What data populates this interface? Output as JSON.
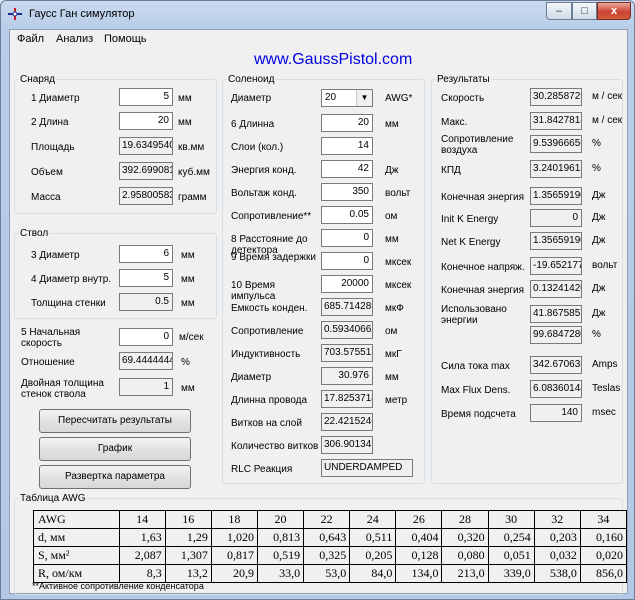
{
  "window": {
    "title": "Гаусс Ган симулятор",
    "min_glyph": "–",
    "max_glyph": "□",
    "close_glyph": "x"
  },
  "menu": {
    "file": "Файл",
    "analysis": "Анализ",
    "help": "Помощь"
  },
  "url": "www.GaussPistol.com",
  "projectile": {
    "legend": "Снаряд",
    "rows": [
      {
        "label": "1 Диаметр",
        "value": "5",
        "unit": "мм"
      },
      {
        "label": "2 Длина",
        "value": "20",
        "unit": "мм"
      },
      {
        "label": "Площадь",
        "value": "19.6349540",
        "unit": "кв.мм"
      },
      {
        "label": "Объем",
        "value": "392.699081",
        "unit": "куб.мм"
      },
      {
        "label": "Масса",
        "value": "2.95800583",
        "unit": "грамм"
      }
    ]
  },
  "barrel": {
    "legend": "Ствол",
    "rows": [
      {
        "label": "3 Диаметр",
        "value": "6",
        "unit": "мм"
      },
      {
        "label": "4 Диаметр внутр.",
        "value": "5",
        "unit": "мм"
      },
      {
        "label": "Толщина стенки",
        "value": "0.5",
        "unit": "мм"
      }
    ]
  },
  "misc": {
    "speed_label": "5 Начальная скорость",
    "speed_value": "0",
    "speed_unit": "м/сек",
    "ratio_label": "Отношение",
    "ratio_value": "69.4444444",
    "ratio_unit": "%",
    "double_label": "Двойная толщина стенок ствола",
    "double_value": "1",
    "double_unit": "мм"
  },
  "buttons": {
    "recalc": "Пересчитать результаты",
    "graph": "График",
    "sweep": "Развертка параметра"
  },
  "solenoid": {
    "legend": "Соленоид",
    "awg_label": "Диаметр",
    "awg_value": "20",
    "awg_unit": "AWG*",
    "rows": [
      {
        "label": "6 Длинна",
        "value": "20",
        "unit": "мм"
      },
      {
        "label": "Слои (кол.)",
        "value": "14",
        "unit": ""
      },
      {
        "label": "Энергия конд.",
        "value": "42",
        "unit": "Дж"
      },
      {
        "label": "Вольтаж конд.",
        "value": "350",
        "unit": "вольт"
      },
      {
        "label": "Сопротивление**",
        "value": "0.05",
        "unit": "ом"
      },
      {
        "label": "8 Расстояние до детектора",
        "value": "0",
        "unit": "мм"
      },
      {
        "label": "9 Время задержки",
        "value": "0",
        "unit": "мксек"
      },
      {
        "label": "10 Время импульса",
        "value": "20000",
        "unit": "мксек"
      },
      {
        "label": "Емкость конден.",
        "value": "685.714285",
        "unit": "мкФ"
      },
      {
        "label": "Сопротивление",
        "value": "0.59340662",
        "unit": "ом"
      },
      {
        "label": "Индуктивность",
        "value": "703.575513",
        "unit": "мкГ"
      },
      {
        "label": "Диаметр",
        "value": "30.976",
        "unit": "мм"
      },
      {
        "label": "Длинна провода",
        "value": "17.8253718",
        "unit": "метр"
      },
      {
        "label": "Витков на слой",
        "value": "22.4215246",
        "unit": ""
      },
      {
        "label": "Количество витков",
        "value": "306.901345",
        "unit": ""
      },
      {
        "label": "RLC Реакция",
        "value": "UNDERDAMPED",
        "unit": ""
      }
    ]
  },
  "results": {
    "legend": "Результаты",
    "rows": [
      {
        "label": "Скорость",
        "value": "30.2858729",
        "unit": "м / сек"
      },
      {
        "label": "Макс.",
        "value": "31.8427818",
        "unit": "м / сек"
      },
      {
        "label": "Сопротивление воздуха",
        "value": "9.53966656",
        "unit": "%"
      },
      {
        "label": "КПД",
        "value": "3.24019615",
        "unit": "%"
      },
      {
        "label": "Конечная энергия",
        "value": "1.35659190",
        "unit": "Дж"
      },
      {
        "label": "Init K Energy",
        "value": "0",
        "unit": "Дж"
      },
      {
        "label": "Net K Energy",
        "value": "1.35659190",
        "unit": "Дж"
      },
      {
        "label": "Конечное напряж.",
        "value": "-19.652177",
        "unit": "вольт"
      },
      {
        "label": "Конечная энергия",
        "value": "0.13241420",
        "unit": "Дж"
      },
      {
        "label": "Использовано энергии",
        "value": "41.8675857",
        "unit": "Дж"
      },
      {
        "label": "",
        "value": "99.6847280",
        "unit": "%"
      },
      {
        "label": "Сила тока max",
        "value": "342.670635",
        "unit": "Amps"
      },
      {
        "label": "Max Flux Dens.",
        "value": "6.08360144",
        "unit": "Teslas"
      },
      {
        "label": "Время подсчета",
        "value": "140",
        "unit": "msec"
      }
    ]
  },
  "awg_table": {
    "legend": "Таблица AWG",
    "rows": [
      {
        "head": "AWG",
        "cells": [
          "14",
          "16",
          "18",
          "20",
          "22",
          "24",
          "26",
          "28",
          "30",
          "32",
          "34"
        ]
      },
      {
        "head": "d, мм",
        "cells": [
          "1,63",
          "1,29",
          "1,020",
          "0,813",
          "0,643",
          "0,511",
          "0,404",
          "0,320",
          "0,254",
          "0,203",
          "0,160"
        ]
      },
      {
        "head": "S, мм²",
        "cells": [
          "2,087",
          "1,307",
          "0,817",
          "0,519",
          "0,325",
          "0,205",
          "0,128",
          "0,080",
          "0,051",
          "0,032",
          "0,020"
        ]
      },
      {
        "head": "R, ом/км",
        "cells": [
          "8,3",
          "13,2",
          "20,9",
          "33,0",
          "53,0",
          "84,0",
          "134,0",
          "213,0",
          "339,0",
          "538,0",
          "856,0"
        ]
      }
    ]
  },
  "footnote": "**Активное сопротивление конденсатора"
}
